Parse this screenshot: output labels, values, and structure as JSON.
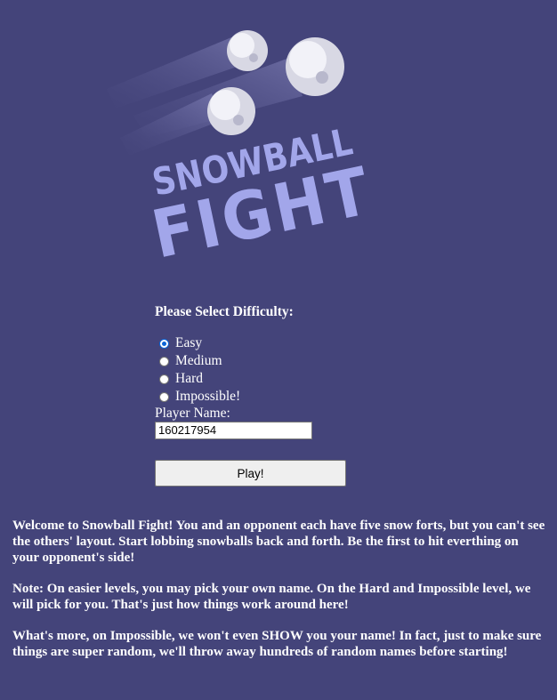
{
  "logo": {
    "line1": "SNOWBALL",
    "line2": "FIGHT",
    "text_color": "#a2a6ea",
    "snowball_color": "#e4e4ec"
  },
  "difficulty": {
    "prompt": "Please Select Difficulty:",
    "options": [
      {
        "label": "Easy",
        "selected": true
      },
      {
        "label": "Medium",
        "selected": false
      },
      {
        "label": "Hard",
        "selected": false
      },
      {
        "label": "Impossible!",
        "selected": false
      }
    ]
  },
  "player": {
    "label": "Player Name:",
    "value": "160217954"
  },
  "play_button": {
    "label": "Play!"
  },
  "info": {
    "paragraph1": "Welcome to Snowball Fight! You and an opponent each have five snow forts, but you can't see the others' layout. Start lobbing snowballs back and forth. Be the first to hit everthing on your opponent's side!",
    "paragraph2": "Note: On easier levels, you may pick your own name. On the Hard and Impossible level, we will pick for you. That's just how things work around here!",
    "paragraph3": "What's more, on Impossible, we won't even SHOW you your name! In fact, just to make sure things are super random, we'll throw away hundreds of random names before starting!"
  },
  "colors": {
    "background": "#44447a",
    "text": "#ffffff",
    "radio_accent": "#0a64d6"
  }
}
